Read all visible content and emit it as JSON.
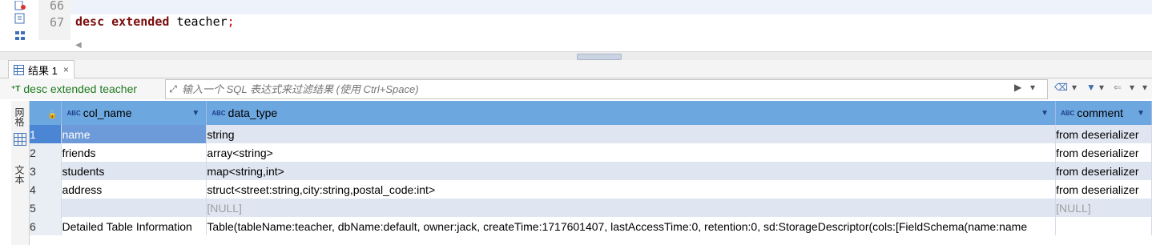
{
  "editor": {
    "lines": [
      {
        "number": "66",
        "code": ""
      },
      {
        "number": "67",
        "kw1": "desc",
        "kw2": "extended",
        "ident": "teacher",
        "semi": ";"
      }
    ]
  },
  "result_tab": {
    "label": "结果 1",
    "close": "×"
  },
  "filter_bar": {
    "query_label": "desc extended teacher",
    "placeholder": "输入一个 SQL 表达式来过滤结果 (使用 Ctrl+Space)"
  },
  "side_panel": {
    "tab_grid": "网格",
    "tab_text": "文本"
  },
  "grid": {
    "columns": [
      "col_name",
      "data_type",
      "comment"
    ],
    "type_badge": "ABC",
    "rows": [
      {
        "num": "1",
        "col_name": "name",
        "data_type": "string",
        "comment": "from deserializer"
      },
      {
        "num": "2",
        "col_name": "friends",
        "data_type": "array<string>",
        "comment": "from deserializer"
      },
      {
        "num": "3",
        "col_name": "students",
        "data_type": "map<string,int>",
        "comment": "from deserializer"
      },
      {
        "num": "4",
        "col_name": "address",
        "data_type": "struct<street:string,city:string,postal_code:int>",
        "comment": "from deserializer"
      },
      {
        "num": "5",
        "col_name": "",
        "data_type": "[NULL]",
        "comment": "[NULL]"
      },
      {
        "num": "6",
        "col_name": "Detailed Table Information",
        "data_type": "Table(tableName:teacher, dbName:default, owner:jack, createTime:1717601407, lastAccessTime:0, retention:0, sd:StorageDescriptor(cols:[FieldSchema(name:name",
        "comment": ""
      }
    ]
  },
  "colors": {
    "header_bg": "#6da7e0",
    "selection": "#4a86d4",
    "keyword": "#7a0d0d",
    "query_label": "#1f7a1f"
  }
}
